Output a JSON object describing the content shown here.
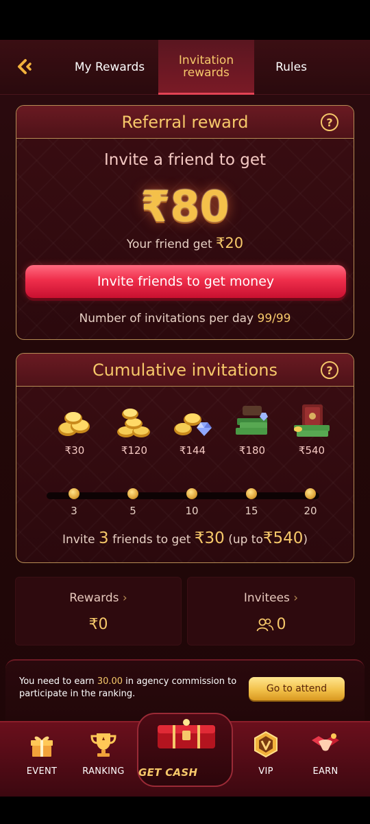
{
  "header": {
    "tabs": [
      {
        "label": "My Rewards"
      },
      {
        "label": "Invitation rewards"
      },
      {
        "label": "Rules"
      }
    ]
  },
  "referral": {
    "title": "Referral reward",
    "subtitle": "Invite a friend to get",
    "amount": "₹80",
    "friend_prefix": "Your friend get",
    "friend_amount": "₹20",
    "invite_button": "Invite friends to get money",
    "limit_prefix": "Number of invitations per day",
    "limit_value": "99/99"
  },
  "cumulative": {
    "title": "Cumulative invitations",
    "tiers": [
      {
        "reward": "₹30",
        "count": "3"
      },
      {
        "reward": "₹120",
        "count": "5"
      },
      {
        "reward": "₹144",
        "count": "10"
      },
      {
        "reward": "₹180",
        "count": "15"
      },
      {
        "reward": "₹540",
        "count": "20"
      }
    ],
    "text_1": "Invite",
    "text_count": "3",
    "text_2": "friends to get",
    "text_amount": "₹30",
    "text_3": "(up to",
    "text_max": "₹540",
    "text_4": ")"
  },
  "stats": {
    "rewards_label": "Rewards",
    "rewards_value": "₹0",
    "invitees_label": "Invitees",
    "invitees_value": "0",
    "arrow": "›"
  },
  "notice": {
    "text_1": "You need to earn",
    "amount": "30.00",
    "text_2": "in agency commission to participate in the ranking.",
    "button": "Go to attend"
  },
  "nav": {
    "event": "EVENT",
    "ranking": "RANKING",
    "get_cash": "GET CASH",
    "vip": "VIP",
    "earn": "EARN"
  },
  "colors": {
    "accent_gold": "#f6c86a",
    "button_red": "#ef2e4b",
    "background": "#2c0b0f"
  }
}
